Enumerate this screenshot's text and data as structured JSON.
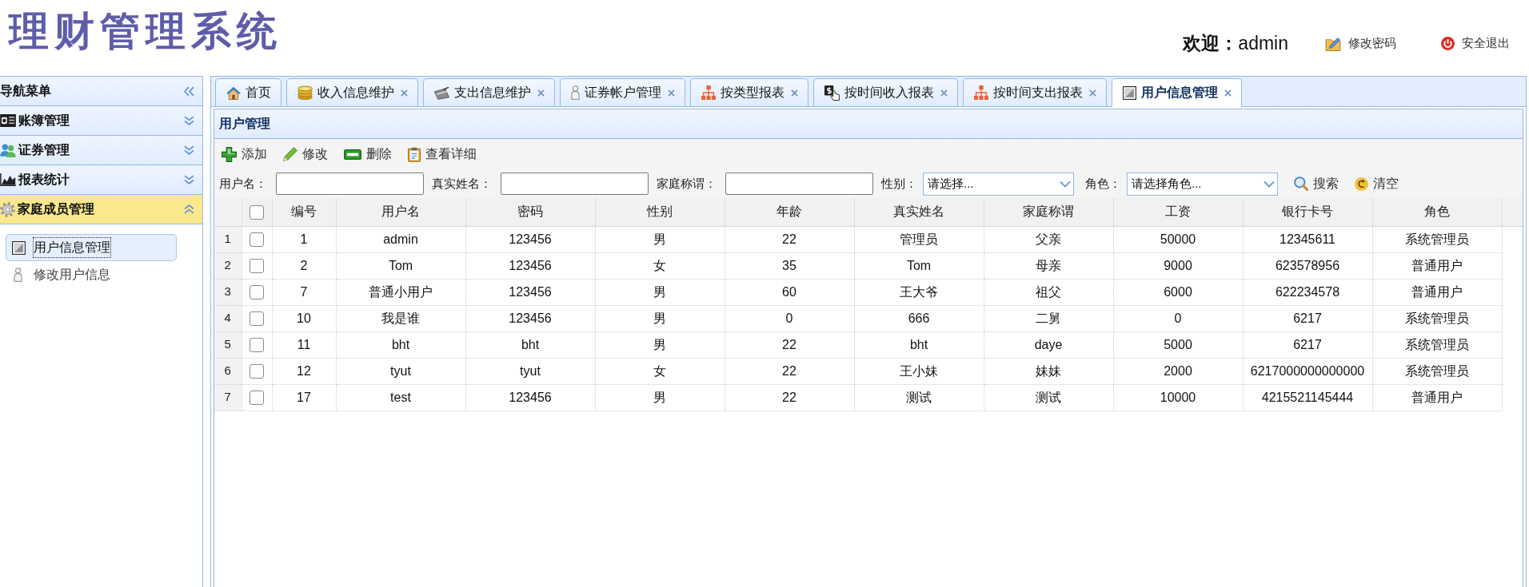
{
  "header": {
    "logo": "理财管理系统",
    "welcome": "**欢迎：**admin",
    "links": [
      {
        "kind": "password",
        "label": "修改密码"
      },
      {
        "kind": "logout",
        "label": "安全退出"
      }
    ]
  },
  "sidebar": {
    "title": "导航菜单",
    "sections": [
      {
        "kind": "device",
        "label": "账簿管理",
        "expanded": false
      },
      {
        "kind": "users",
        "label": "证券管理",
        "expanded": false
      },
      {
        "kind": "chart",
        "label": "报表统计",
        "expanded": false
      },
      {
        "kind": "gear",
        "label": "家庭成员管理",
        "expanded": true,
        "items": [
          {
            "kind": "frame",
            "label": "用户信息管理",
            "selected": true
          },
          {
            "kind": "person",
            "label": "修改用户信息",
            "selected": false
          }
        ]
      }
    ]
  },
  "tabs": [
    {
      "kind": "home",
      "label": "首页",
      "selected": false,
      "closable": false
    },
    {
      "kind": "coins",
      "label": "收入信息维护",
      "selected": false,
      "closable": true
    },
    {
      "kind": "card",
      "label": "支出信息维护",
      "selected": false,
      "closable": true
    },
    {
      "kind": "person",
      "label": "证券帐户管理",
      "selected": false,
      "closable": true
    },
    {
      "kind": "hierarchy",
      "label": "按类型报表",
      "selected": false,
      "closable": true
    },
    {
      "kind": "money",
      "label": "按时间收入报表",
      "selected": false,
      "closable": true
    },
    {
      "kind": "hierarchy",
      "label": "按时间支出报表",
      "selected": false,
      "closable": true
    },
    {
      "kind": "frame",
      "label": "用户信息管理",
      "selected": true,
      "closable": true
    }
  ],
  "panel": {
    "title": "用户管理"
  },
  "toolbar": [
    {
      "kind": "add",
      "label": "添加"
    },
    {
      "kind": "edit",
      "label": "修改"
    },
    {
      "kind": "delete",
      "label": "删除"
    },
    {
      "kind": "detail",
      "label": "查看详细"
    }
  ],
  "filters": [
    {
      "kind": "text",
      "label": "用户名："
    },
    {
      "kind": "text",
      "label": "真实姓名："
    },
    {
      "kind": "text",
      "label": "家庭称谓："
    },
    {
      "kind": "select",
      "label": "性别：",
      "value": "请选择..."
    },
    {
      "kind": "select",
      "label": "角色：",
      "value": "请选择角色..."
    }
  ],
  "actions": [
    {
      "kind": "search",
      "label": "搜索"
    },
    {
      "kind": "clear",
      "label": "清空"
    }
  ],
  "table": {
    "header_checked": false,
    "columns": [
      "编号",
      "用户名",
      "密码",
      "性别",
      "年龄",
      "真实姓名",
      "家庭称谓",
      "工资",
      "银行卡号",
      "角色"
    ],
    "rows": [
      {
        "number": "1",
        "checked": false,
        "cells": [
          "1",
          "admin",
          "123456",
          "男",
          "22",
          "管理员",
          "父亲",
          "50000",
          "12345611",
          "系统管理员"
        ]
      },
      {
        "number": "2",
        "checked": false,
        "cells": [
          "2",
          "Tom",
          "123456",
          "女",
          "35",
          "Tom",
          "母亲",
          "9000",
          "623578956",
          "普通用户"
        ]
      },
      {
        "number": "3",
        "checked": false,
        "cells": [
          "7",
          "普通小用户",
          "123456",
          "男",
          "60",
          "王大爷",
          "祖父",
          "6000",
          "622234578",
          "普通用户"
        ]
      },
      {
        "number": "4",
        "checked": false,
        "cells": [
          "10",
          "我是谁",
          "123456",
          "男",
          "0",
          "666",
          "二舅",
          "0",
          "6217",
          "系统管理员"
        ]
      },
      {
        "number": "5",
        "checked": false,
        "cells": [
          "11",
          "bht",
          "bht",
          "男",
          "22",
          "bht",
          "daye",
          "5000",
          "6217",
          "系统管理员"
        ]
      },
      {
        "number": "6",
        "checked": false,
        "cells": [
          "12",
          "tyut",
          "tyut",
          "女",
          "22",
          "王小妹",
          "妹妹",
          "2000",
          "6217000000000000",
          "系统管理员"
        ]
      },
      {
        "number": "7",
        "checked": false,
        "cells": [
          "17",
          "test",
          "123456",
          "男",
          "22",
          "测试",
          "测试",
          "10000",
          "4215521145444",
          "普通用户"
        ]
      }
    ]
  }
}
